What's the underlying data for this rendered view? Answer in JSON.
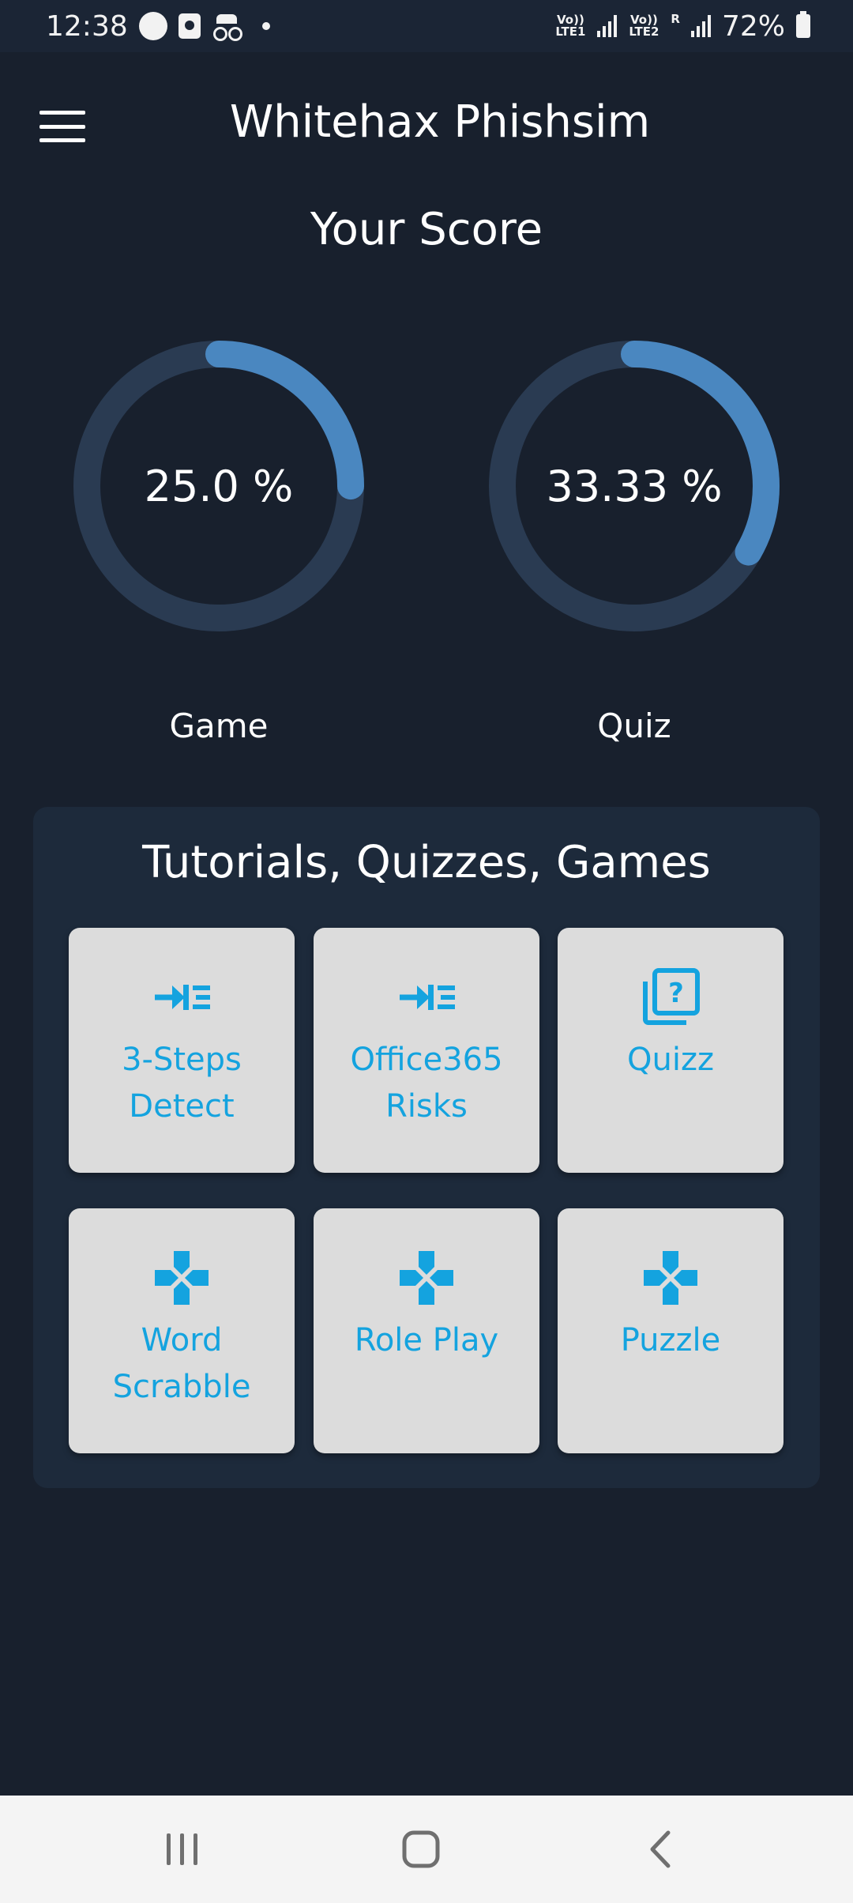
{
  "status_bar": {
    "time": "12:38",
    "sim1_label": "Vo)) LTE1",
    "sim2_label": "Vo)) LTE2",
    "roaming": "R",
    "battery": "72%"
  },
  "header": {
    "title": "Whitehax Phishsim",
    "menu_icon": "hamburger-menu-icon"
  },
  "score": {
    "title": "Your Score",
    "game": {
      "value_text": "25.0 %",
      "fraction": 0.25,
      "label": "Game"
    },
    "quiz": {
      "value_text": "33.33 %",
      "fraction": 0.3333,
      "label": "Quiz"
    },
    "colors": {
      "track": "#2a3b52",
      "progress": "#4a87c0"
    }
  },
  "tutorials": {
    "title": "Tutorials, Quizzes, Games",
    "items": [
      {
        "label": "3-Steps\nDetect",
        "icon": "steps-arrow-icon"
      },
      {
        "label": "Office365\nRisks",
        "icon": "steps-arrow-icon"
      },
      {
        "label": "Quizz",
        "icon": "quiz-question-icon"
      },
      {
        "label": "Word\nScrabble",
        "icon": "gamepad-icon"
      },
      {
        "label": "Role Play",
        "icon": "gamepad-icon"
      },
      {
        "label": "Puzzle",
        "icon": "gamepad-icon"
      }
    ],
    "colors": {
      "accent": "#14a3df",
      "tile_bg": "#dcdcdc"
    }
  },
  "nav": {
    "recent_icon": "recent-apps-icon",
    "home_icon": "home-icon",
    "back_icon": "back-icon"
  }
}
